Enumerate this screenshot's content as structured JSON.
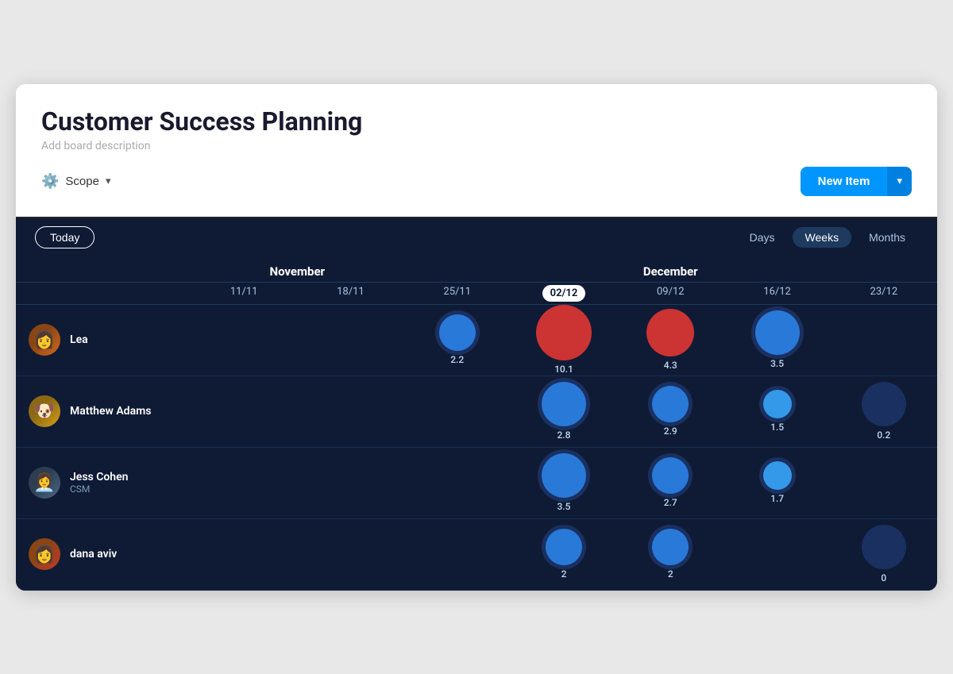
{
  "header": {
    "title": "Customer Success Planning",
    "description": "Add board description",
    "scope_label": "Scope",
    "new_item_label": "New Item"
  },
  "toolbar": {
    "today_label": "Today",
    "view_days": "Days",
    "view_weeks": "Weeks",
    "view_months": "Months",
    "active_view": "Weeks"
  },
  "months": [
    {
      "label": "November",
      "span": "nov"
    },
    {
      "label": "December",
      "span": "dec"
    }
  ],
  "dates": [
    {
      "label": "11/11",
      "today": false
    },
    {
      "label": "18/11",
      "today": false
    },
    {
      "label": "25/11",
      "today": false
    },
    {
      "label": "02/12",
      "today": true
    },
    {
      "label": "09/12",
      "today": false
    },
    {
      "label": "16/12",
      "today": false
    },
    {
      "label": "23/12",
      "today": false
    }
  ],
  "rows": [
    {
      "name": "Lea",
      "role": "",
      "avatar_class": "avatar-lea",
      "avatar_emoji": "👩",
      "cells": [
        {
          "value": "",
          "bubble": ""
        },
        {
          "value": "",
          "bubble": ""
        },
        {
          "value": "2.2",
          "bubble": "blue-md"
        },
        {
          "value": "10.1",
          "bubble": "red-lg"
        },
        {
          "value": "4.3",
          "bubble": "red-md"
        },
        {
          "value": "3.5",
          "bubble": "blue-lg"
        },
        {
          "value": "",
          "bubble": ""
        }
      ]
    },
    {
      "name": "Matthew Adams",
      "role": "",
      "avatar_class": "avatar-matthew",
      "avatar_emoji": "🐶",
      "cells": [
        {
          "value": "",
          "bubble": ""
        },
        {
          "value": "",
          "bubble": ""
        },
        {
          "value": "",
          "bubble": ""
        },
        {
          "value": "2.8",
          "bubble": "blue-lg"
        },
        {
          "value": "2.9",
          "bubble": "blue-md"
        },
        {
          "value": "1.5",
          "bubble": "blue-sm"
        },
        {
          "value": "0.2",
          "bubble": "dark-lg"
        }
      ]
    },
    {
      "name": "Jess Cohen",
      "role": "CSM",
      "avatar_class": "avatar-jess",
      "avatar_emoji": "👩‍💼",
      "cells": [
        {
          "value": "",
          "bubble": ""
        },
        {
          "value": "",
          "bubble": ""
        },
        {
          "value": "",
          "bubble": ""
        },
        {
          "value": "3.5",
          "bubble": "blue-lg"
        },
        {
          "value": "2.7",
          "bubble": "blue-md"
        },
        {
          "value": "1.7",
          "bubble": "blue-sm"
        },
        {
          "value": "",
          "bubble": ""
        }
      ]
    },
    {
      "name": "dana aviv",
      "role": "",
      "avatar_class": "avatar-dana",
      "avatar_emoji": "👩",
      "cells": [
        {
          "value": "",
          "bubble": ""
        },
        {
          "value": "",
          "bubble": ""
        },
        {
          "value": "",
          "bubble": ""
        },
        {
          "value": "2",
          "bubble": "blue-md"
        },
        {
          "value": "2",
          "bubble": "blue-md"
        },
        {
          "value": "",
          "bubble": ""
        },
        {
          "value": "0",
          "bubble": "dark-lg"
        }
      ]
    }
  ],
  "colors": {
    "accent_blue": "#0095ff",
    "bg_dark": "#0f1b35",
    "bubble_blue": "#2979d9",
    "bubble_red": "#d94040",
    "bubble_dark": "#1a3060"
  }
}
